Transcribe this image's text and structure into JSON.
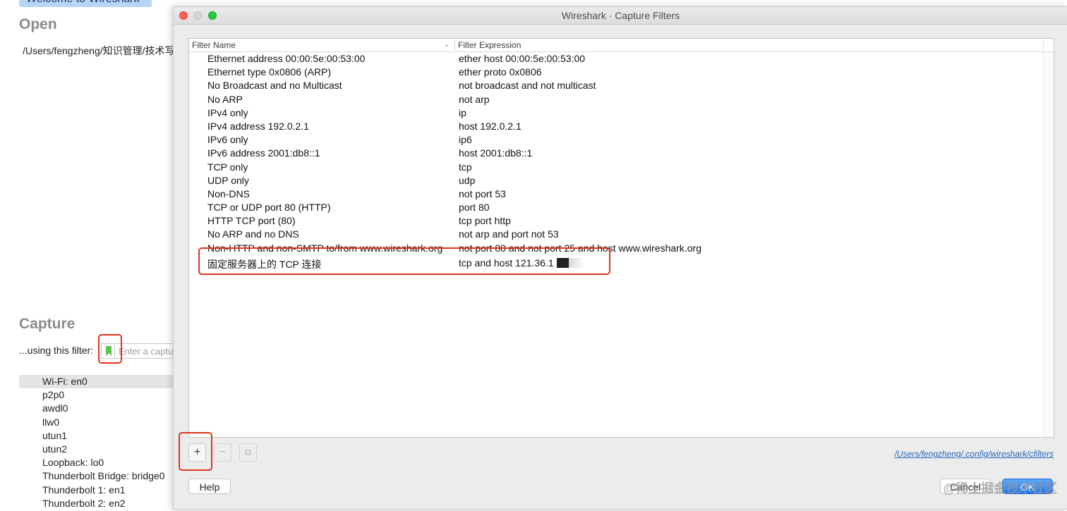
{
  "background": {
    "welcome_tab": "Welcome to Wireshark",
    "open_title": "Open",
    "recent_file": "/Users/fengzheng/知识管理/技术写",
    "capture_title": "Capture",
    "filter_label": "...using this filter:",
    "filter_placeholder": "Enter a capture filter",
    "interfaces": [
      "Wi-Fi: en0",
      "p2p0",
      "awdl0",
      "llw0",
      "utun1",
      "utun2",
      "Loopback: lo0",
      "Thunderbolt Bridge: bridge0",
      "Thunderbolt 1: en1",
      "Thunderbolt 2: en2"
    ],
    "selected_interface": 0
  },
  "dialog": {
    "title": "Wireshark · Capture Filters",
    "columns": {
      "name": "Filter Name",
      "expression": "Filter Expression",
      "sort_glyph": "⌄"
    },
    "filters": [
      {
        "name": "Ethernet address 00:00:5e:00:53:00",
        "expression": "ether host 00:00:5e:00:53:00"
      },
      {
        "name": "Ethernet type 0x0806 (ARP)",
        "expression": "ether proto 0x0806"
      },
      {
        "name": "No Broadcast and no Multicast",
        "expression": "not broadcast and not multicast"
      },
      {
        "name": "No ARP",
        "expression": "not arp"
      },
      {
        "name": "IPv4 only",
        "expression": "ip"
      },
      {
        "name": "IPv4 address 192.0.2.1",
        "expression": "host 192.0.2.1"
      },
      {
        "name": "IPv6 only",
        "expression": "ip6"
      },
      {
        "name": "IPv6 address 2001:db8::1",
        "expression": "host 2001:db8::1"
      },
      {
        "name": "TCP only",
        "expression": "tcp"
      },
      {
        "name": "UDP only",
        "expression": "udp"
      },
      {
        "name": "Non-DNS",
        "expression": "not port 53"
      },
      {
        "name": "TCP or UDP port 80 (HTTP)",
        "expression": "port 80"
      },
      {
        "name": "HTTP TCP port (80)",
        "expression": "tcp port http"
      },
      {
        "name": "No ARP and no DNS",
        "expression": "not arp and port not 53"
      },
      {
        "name": "Non-HTTP and non-SMTP to/from www.wireshark.org",
        "expression": "not port 80 and not port 25 and host www.wireshark.org"
      },
      {
        "name": "固定服务器上的 TCP 连接",
        "expression": "tcp and host 121.36.1"
      }
    ],
    "tools": {
      "add": "+",
      "remove": "−",
      "copy": "⧉"
    },
    "config_path": "/Users/fengzheng/.config/wireshark/cfilters",
    "buttons": {
      "help": "Help",
      "cancel": "Cancel",
      "ok": "OK"
    }
  },
  "watermark": "@稀土掘金技术社区",
  "colors": {
    "highlight": "#e2321e",
    "ok_button": "#1a77f2",
    "bookmark": "#5fc24a",
    "selected_row": "#e4e4e4"
  }
}
